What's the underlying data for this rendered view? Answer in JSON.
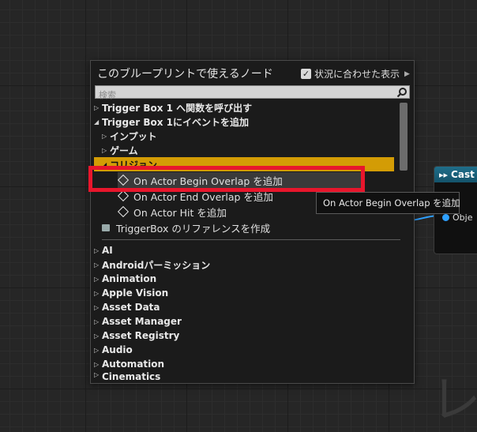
{
  "watermark_text": "レ",
  "cast_node": {
    "title": "Cast",
    "pin_label": "Obje"
  },
  "panel": {
    "title": "このブループリントで使えるノード",
    "context_sensitive_label": "状況に合わせた表示",
    "context_sensitive_checked": true,
    "search_placeholder": "検索",
    "search_value": ""
  },
  "tree": {
    "trigger_functions": "Trigger Box 1 へ関数を呼び出す",
    "trigger_events": "Trigger Box 1にイベントを追加",
    "input": "インプット",
    "game": "ゲーム",
    "collision": "コリジョン",
    "events": [
      "On Actor Begin Overlap を追加",
      "On Actor End Overlap を追加",
      "On Actor Hit を追加"
    ],
    "reference": "TriggerBox のリファレンスを作成",
    "categories": [
      "AI",
      "Androidパーミッション",
      "Animation",
      "Apple Vision",
      "Asset Data",
      "Asset Manager",
      "Asset Registry",
      "Audio",
      "Automation",
      "Cinematics"
    ]
  },
  "tooltip": "On Actor Begin Overlap を追加",
  "colors": {
    "category_highlight": "#d39c05",
    "annotation_box": "#e8162c",
    "pin": "#2ea0ff"
  }
}
